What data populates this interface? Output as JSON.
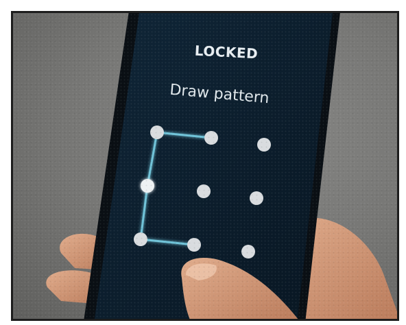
{
  "screen": {
    "title": "LOCKED",
    "prompt": "Draw pattern"
  },
  "pattern": {
    "dot_color": "#d9dcdf",
    "line_color": "#6fc3d8",
    "screen_color": "#0c1e2d",
    "active_dots": [
      0,
      1,
      3,
      6,
      7
    ]
  }
}
